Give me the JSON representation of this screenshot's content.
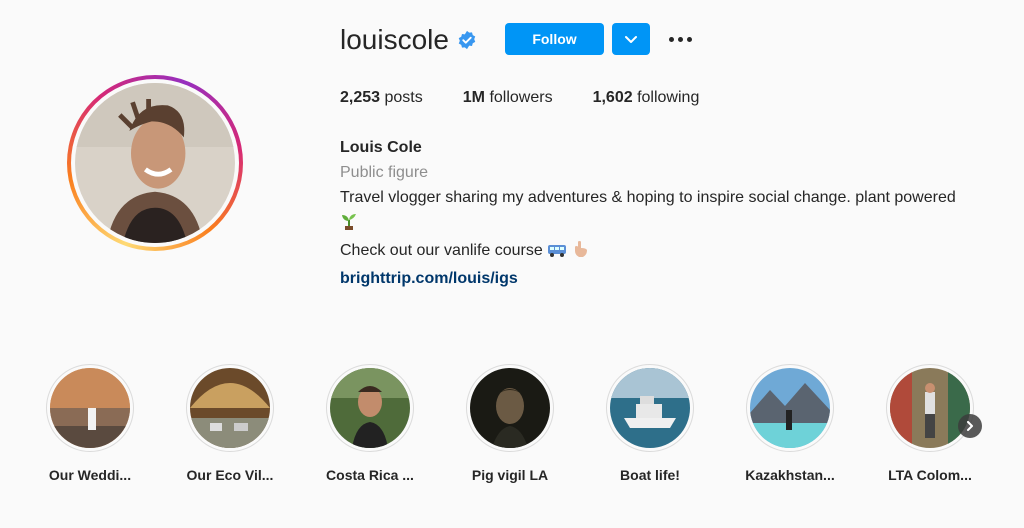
{
  "profile": {
    "username": "louiscole",
    "verified_icon": "verified-badge-icon",
    "follow_label": "Follow",
    "stats": {
      "posts_count": "2,253",
      "posts_label": "posts",
      "followers_count": "1M",
      "followers_label": "followers",
      "following_count": "1,602",
      "following_label": "following"
    },
    "bio": {
      "name": "Louis Cole",
      "category": "Public figure",
      "line1": "Travel vlogger sharing my adventures & hoping to inspire social change. plant powered",
      "line2": "Check out our vanlife course",
      "link": "brighttrip.com/louis/igs"
    }
  },
  "highlights": [
    {
      "label": "Our Weddi..."
    },
    {
      "label": "Our Eco Vil..."
    },
    {
      "label": "Costa Rica ..."
    },
    {
      "label": "Pig vigil LA"
    },
    {
      "label": "Boat life!"
    },
    {
      "label": "Kazakhstan..."
    },
    {
      "label": "LTA Colom..."
    }
  ],
  "colors": {
    "accent": "#0095f6",
    "link": "#00376b",
    "muted": "#8e8e8e",
    "verified": "#3897f0"
  }
}
